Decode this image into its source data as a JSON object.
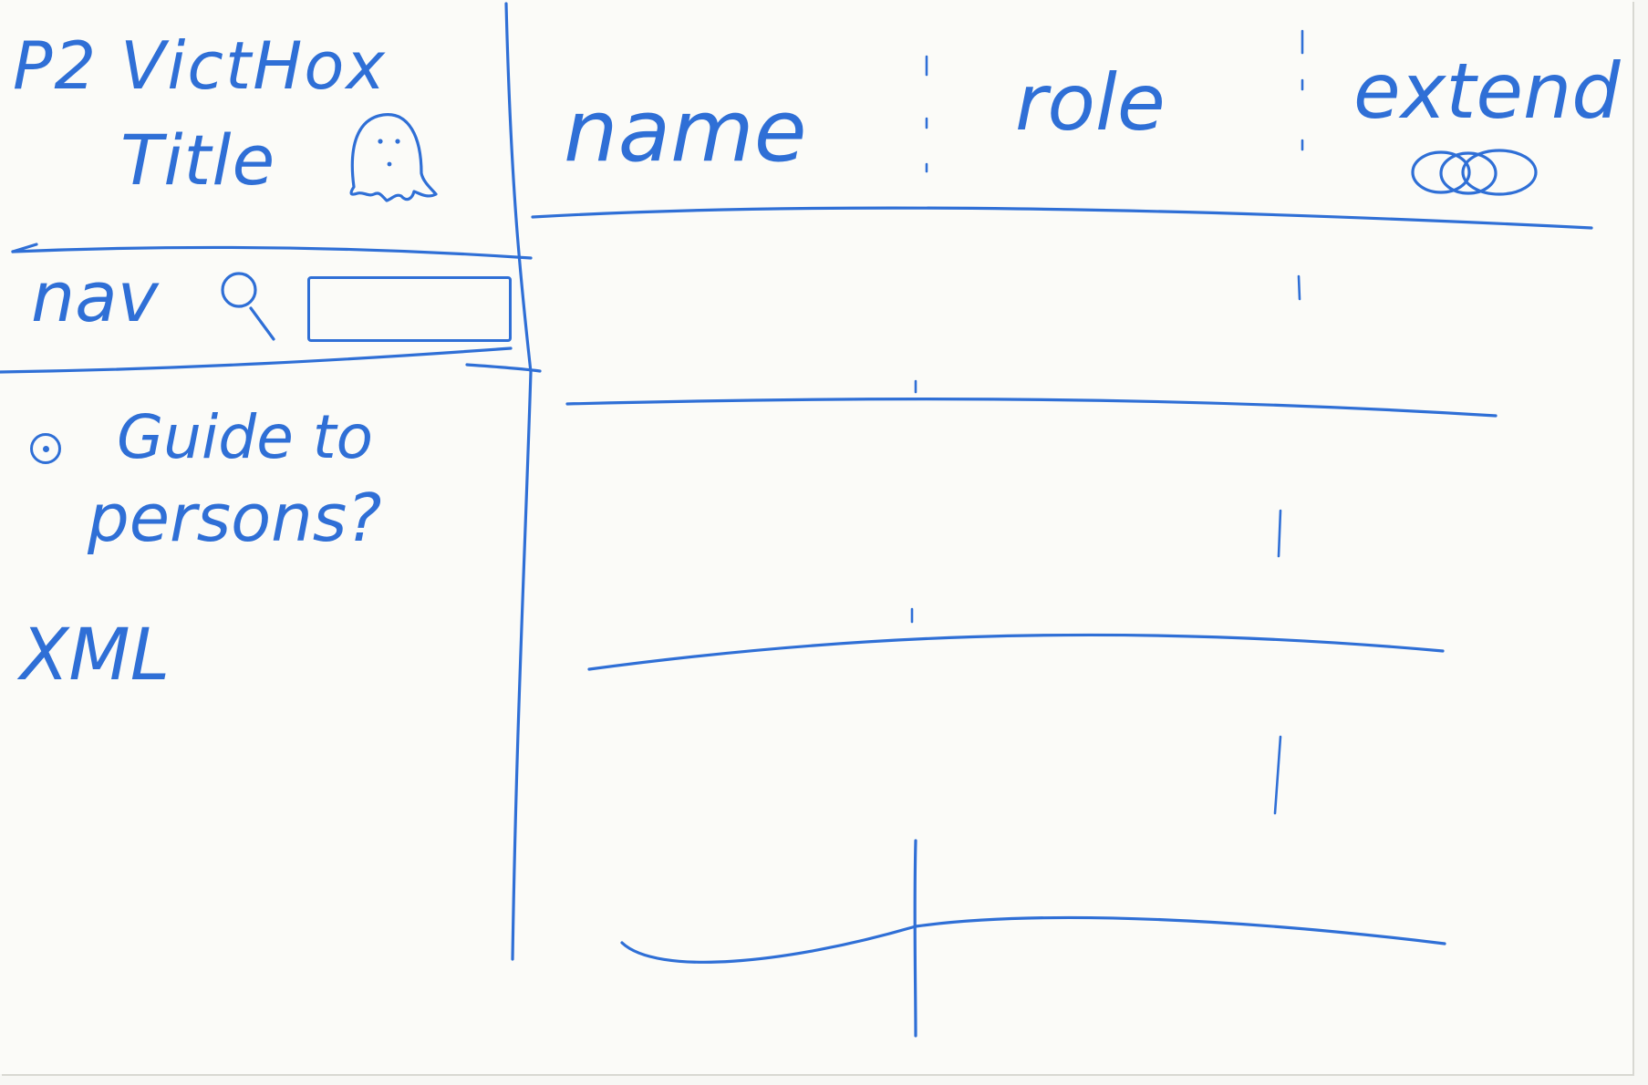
{
  "header": {
    "title_line1": "P2 VictHox",
    "title_line2": "Title"
  },
  "nav": {
    "label": "nav",
    "search_placeholder": ""
  },
  "sidebar": {
    "items": [
      {
        "label_line1": "Guide to",
        "label_line2": "persons?"
      },
      {
        "label": "XML"
      }
    ]
  },
  "table": {
    "columns": [
      "name",
      "role",
      "extend"
    ],
    "row_count": 4
  },
  "icons": {
    "title_icon": "ghost-icon",
    "search_icon": "search-icon",
    "extend_icon": "link-icon",
    "option_icon": "radio-icon"
  },
  "colors": {
    "ink": "#2f6fd6",
    "paper": "#fbfbf8"
  }
}
